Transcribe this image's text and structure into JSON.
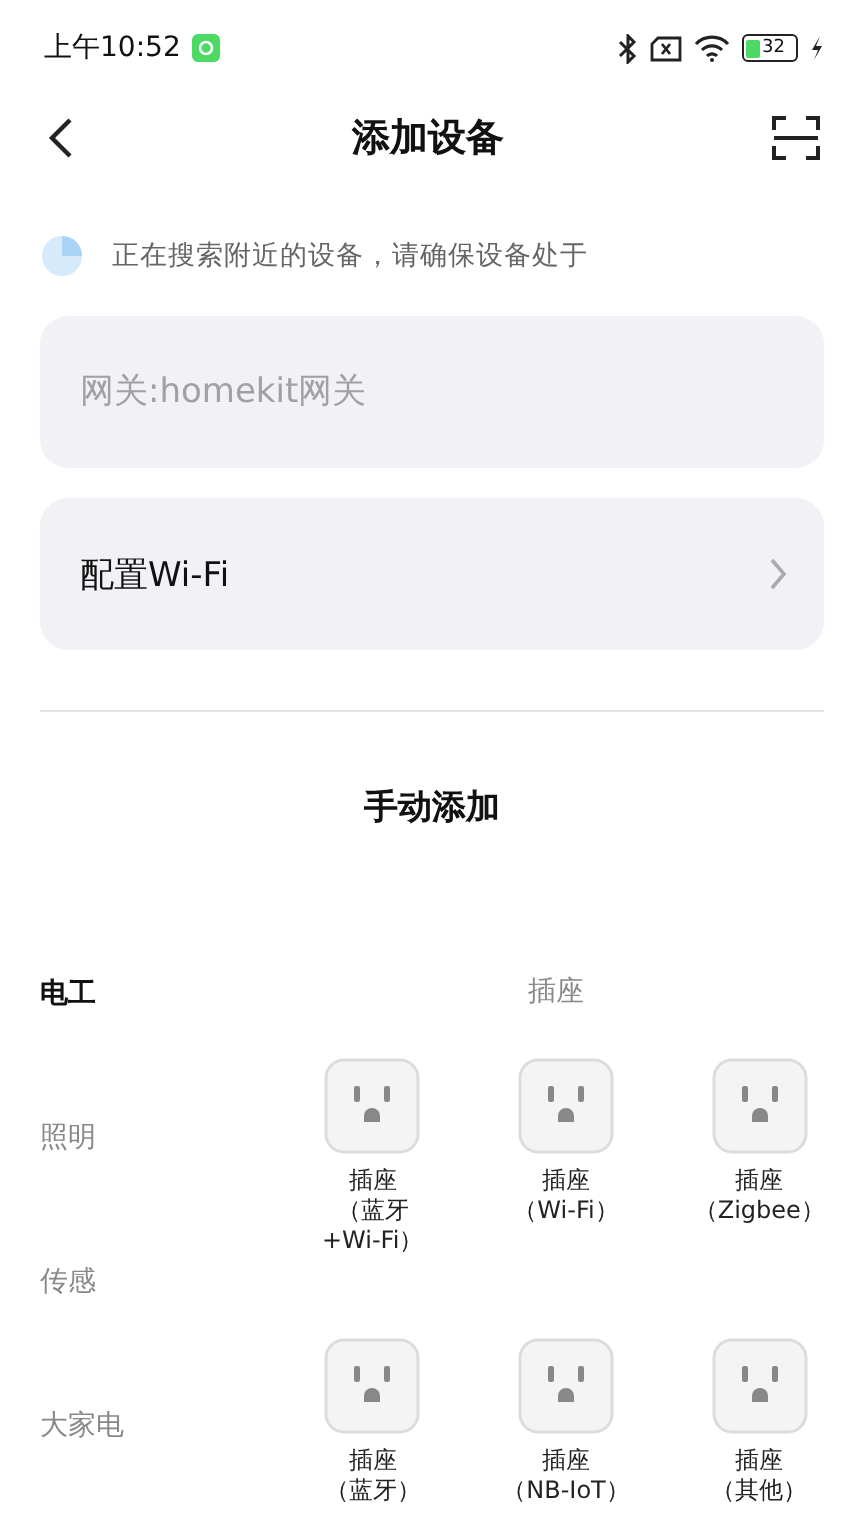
{
  "status_bar": {
    "time": "上午10:52",
    "battery": "32"
  },
  "header": {
    "title": "添加设备"
  },
  "search_notice": "正在搜索附近的设备，请确保设备处于",
  "gateway_field": {
    "placeholder": "网关:homekit网关"
  },
  "wifi_row": {
    "label": "配置Wi-Fi"
  },
  "manual_title": "手动添加",
  "categories": [
    {
      "label": "电工",
      "selected": true
    },
    {
      "label": "照明",
      "selected": false
    },
    {
      "label": "传感",
      "selected": false
    },
    {
      "label": "大家电",
      "selected": false
    }
  ],
  "section_title": "插座",
  "devices": [
    {
      "label_lines": [
        "插座",
        "（蓝牙",
        "+Wi-Fi）"
      ]
    },
    {
      "label_lines": [
        "插座",
        "（Wi-Fi）"
      ]
    },
    {
      "label_lines": [
        "插座",
        "（Zigbee）"
      ]
    },
    {
      "label_lines": [
        "插座",
        "（蓝牙）"
      ]
    },
    {
      "label_lines": [
        "插座",
        "（NB-IoT）"
      ]
    },
    {
      "label_lines": [
        "插座",
        "（其他）"
      ]
    }
  ]
}
